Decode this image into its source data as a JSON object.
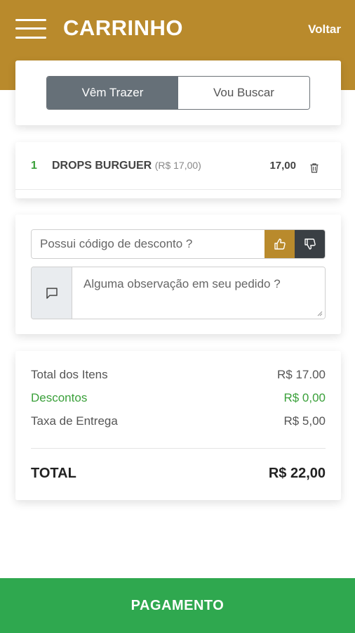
{
  "header": {
    "title": "CARRINHO",
    "back_label": "Voltar",
    "background_color": "#b98a2c"
  },
  "delivery_options": [
    {
      "label": "Vêm Trazer",
      "selected": true
    },
    {
      "label": "Vou Buscar",
      "selected": false
    }
  ],
  "cart_items": [
    {
      "quantity": "1",
      "name": "DROPS BURGUER",
      "unit_price": "(R$ 17,00)",
      "total": "17,00",
      "icon": "trash-icon"
    }
  ],
  "discount": {
    "placeholder": "Possui código de desconto ?",
    "apply_icon": "thumbs-up-icon",
    "remove_icon": "thumbs-down-icon"
  },
  "observation": {
    "placeholder": "Alguma observação em seu pedido ?",
    "icon": "chat-bubble-icon"
  },
  "summary": {
    "items_label": "Total dos Itens",
    "items_value": "R$ 17.00",
    "discount_label": "Descontos",
    "discount_value": "R$ 0,00",
    "delivery_label": "Taxa de Entrega",
    "delivery_value": "R$ 5,00",
    "total_label": "TOTAL",
    "total_value": "R$ 22,00"
  },
  "payment_button": {
    "label": "PAGAMENTO",
    "color": "#2fa84f"
  }
}
